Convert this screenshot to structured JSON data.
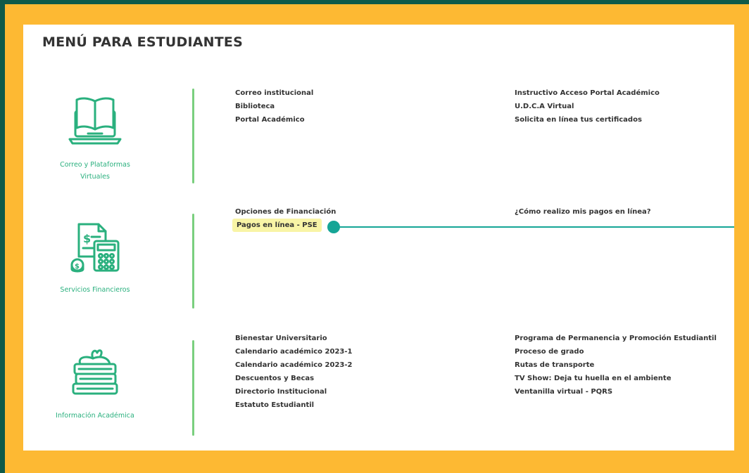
{
  "colors": {
    "frame": "#FDB933",
    "frame_edge": "#0E5A49",
    "panel": "#ffffff",
    "accent_green": "#2AB07E",
    "divider_green": "#7ACF7E",
    "pointer_teal": "#15A596",
    "highlight": "#F8F4A6"
  },
  "page": {
    "title": "MENÚ PARA ESTUDIANTES"
  },
  "sections": [
    {
      "icon": "laptop-book-icon",
      "label_line1": "Correo y Plataformas",
      "label_line2": "Virtuales",
      "col1": [
        "Correo institucional",
        "Biblioteca",
        "Portal Académico"
      ],
      "col2": [
        "Instructivo Acceso Portal Académico",
        "U.D.C.A Virtual",
        "Solicita en línea tus certificados"
      ]
    },
    {
      "icon": "calculator-money-icon",
      "label_line1": "Servicios Financieros",
      "col1": [
        "Opciones de Financiación",
        "Pagos en línea - PSE"
      ],
      "col2": [
        "¿Cómo realizo mis pagos en línea?"
      ]
    },
    {
      "icon": "books-stack-icon",
      "label_line1": "Información Académica",
      "col1": [
        "Bienestar Universitario",
        "Calendario académico 2023-1",
        "Calendario académico 2023-2",
        "Descuentos y Becas",
        "Directorio Institucional",
        "Estatuto Estudiantil"
      ],
      "col2": [
        "Programa de Permanencia y Promoción Estudiantil",
        "Proceso de grado",
        "Rutas de transporte",
        "TV Show: Deja tu huella en el ambiente",
        "Ventanilla virtual - PQRS"
      ]
    }
  ]
}
